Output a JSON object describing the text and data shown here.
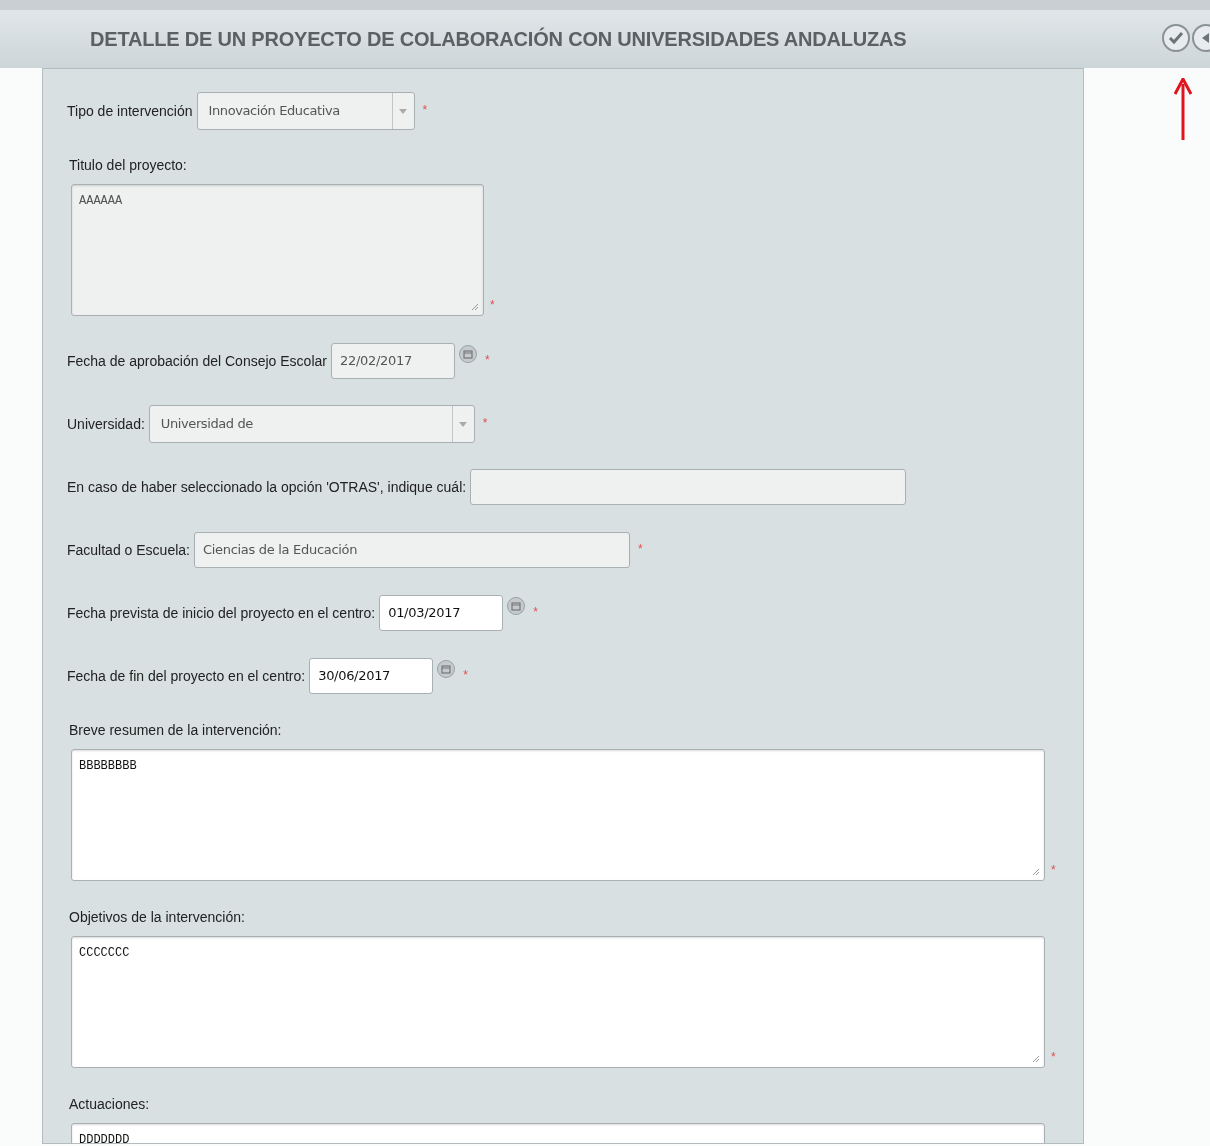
{
  "header": {
    "title": "DETALLE DE UN PROYECTO DE COLABORACIÓN CON UNIVERSIDADES ANDALUZAS"
  },
  "toolbar": [
    {
      "kind": "accept"
    },
    {
      "kind": "back"
    }
  ],
  "annotation": {
    "kind": "arrow"
  },
  "fields": [
    {
      "kind": "select",
      "label": "Tipo de intervención",
      "value": "Innovación Educativa",
      "disabled": true,
      "required_mark": "*"
    },
    {
      "kind": "textarea",
      "label": "Titulo del proyecto:",
      "value": "AAAAAA",
      "disabled": true,
      "required_mark": "*"
    },
    {
      "kind": "date",
      "label": "Fecha de aprobación del Consejo Escolar",
      "value": "22/02/2017",
      "disabled": true,
      "required_mark": "*"
    },
    {
      "kind": "select",
      "label": "Universidad:",
      "value": "Universidad de",
      "disabled": true,
      "required_mark": "*"
    },
    {
      "kind": "text",
      "label": "En caso de haber seleccionado la opción 'OTRAS', indique cuál:",
      "disabled": true
    },
    {
      "kind": "text",
      "label": "Facultad o Escuela:",
      "value": "Ciencias de la Educación",
      "disabled": true,
      "required_mark": "*"
    },
    {
      "kind": "date",
      "label": "Fecha prevista de inicio del proyecto en el centro:",
      "value": "01/03/2017",
      "disabled": false,
      "required_mark": "*"
    },
    {
      "kind": "date",
      "label": "Fecha de fin del proyecto en el centro:",
      "value": "30/06/2017",
      "disabled": false,
      "required_mark": "*"
    },
    {
      "kind": "textarea",
      "label": "Breve resumen de la intervención:",
      "value": "BBBBBBBB",
      "disabled": false,
      "required_mark": "*"
    },
    {
      "kind": "textarea",
      "label": "Objetivos de la intervención:",
      "value": "CCCCCCC",
      "disabled": false,
      "required_mark": "*"
    },
    {
      "kind": "textarea",
      "label": "Actuaciones:",
      "value": "DDDDDDD",
      "disabled": false
    }
  ]
}
